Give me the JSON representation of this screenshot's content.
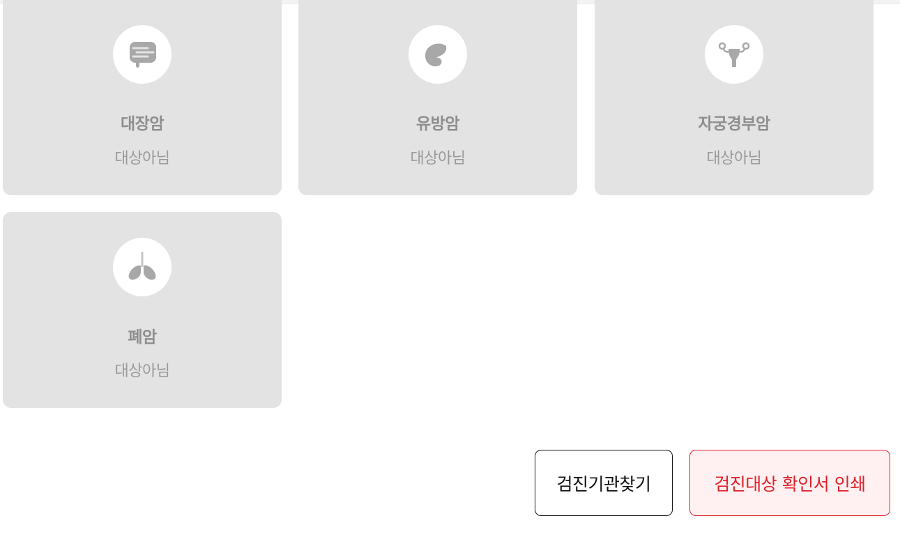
{
  "cards": [
    {
      "title": "대장암",
      "status": "대상아님",
      "icon": "colon-icon"
    },
    {
      "title": "유방암",
      "status": "대상아님",
      "icon": "breast-icon"
    },
    {
      "title": "자궁경부암",
      "status": "대상아님",
      "icon": "uterus-icon"
    },
    {
      "title": "폐암",
      "status": "대상아님",
      "icon": "lungs-icon"
    }
  ],
  "buttons": {
    "find_institution": "검진기관찾기",
    "print_confirmation": "검진대상 확인서 인쇄"
  },
  "colors": {
    "card_bg": "#e3e3e3",
    "icon_fill": "#a8a8a8",
    "accent_red": "#e0202a",
    "print_bg": "#fff1f1"
  }
}
